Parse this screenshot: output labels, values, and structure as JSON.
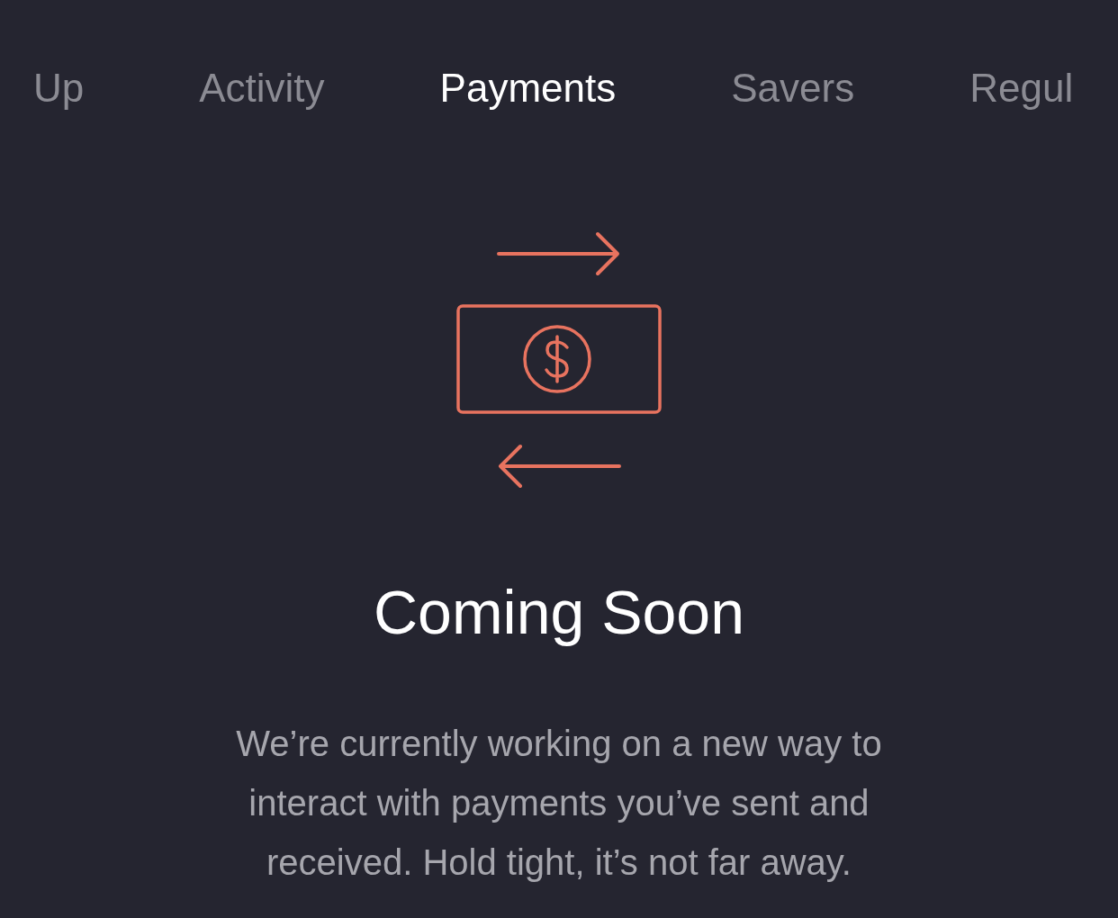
{
  "tabs": [
    {
      "label": "Up",
      "selected": false
    },
    {
      "label": "Activity",
      "selected": false
    },
    {
      "label": "Payments",
      "selected": true
    },
    {
      "label": "Savers",
      "selected": false
    },
    {
      "label": "Regul",
      "selected": false
    }
  ],
  "empty_state": {
    "title": "Coming Soon",
    "message": "We’re currently working on a new way to interact with payments you’ve sent and received. Hold tight, it’s not far away."
  }
}
